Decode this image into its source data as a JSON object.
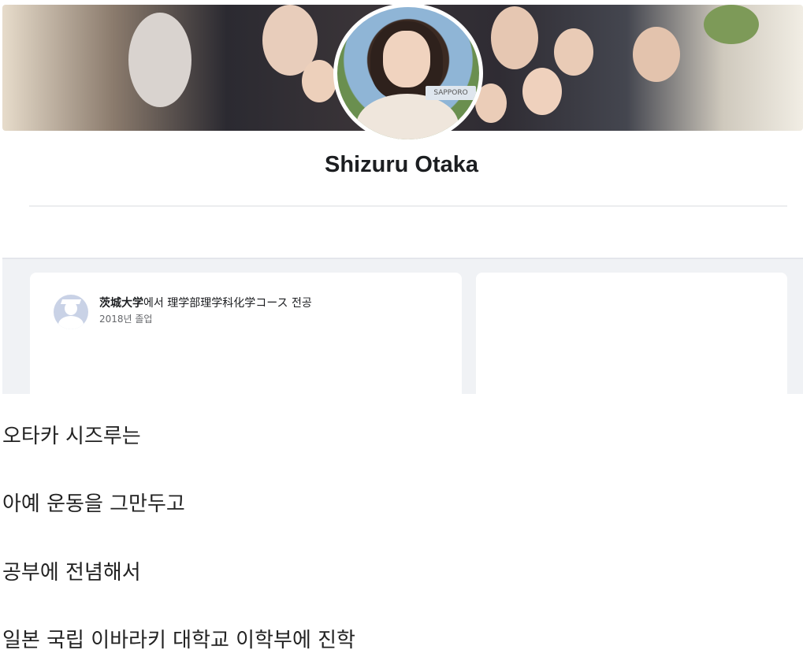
{
  "profile": {
    "name": "Shizuru Otaka",
    "sign_text": "SAPPORO"
  },
  "education": {
    "school": "茨城大学",
    "connector": "에서",
    "major": "理学部理学科化学コース 전공",
    "graduation": "2018년 졸업"
  },
  "article": {
    "paragraphs": [
      "오타카 시즈루는",
      "아예 운동을 그만두고",
      "공부에 전념해서",
      "일본 국립 이바라키 대학교 이학부에 진학"
    ]
  }
}
